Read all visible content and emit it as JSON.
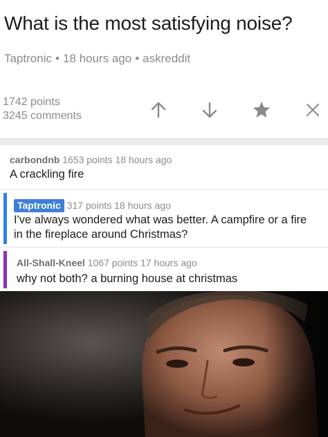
{
  "post": {
    "title": "What is the most satisfying noise?",
    "author": "Taptronic",
    "time": "18 hours ago",
    "subreddit": "askreddit",
    "points": "1742 points",
    "comments": "3245 comments"
  },
  "actions": {
    "icons": [
      "upvote-arrow-icon",
      "downvote-arrow-icon",
      "star-icon",
      "close-icon"
    ]
  },
  "comments": [
    {
      "author": "carbondnb",
      "meta": "1653 points 18 hours ago",
      "body": "A crackling fire"
    },
    {
      "author": "Taptronic",
      "meta": "317 points 18 hours ago",
      "body": "I've always wondered what was better. A campfire or a fire in the fireplace around Christmas?"
    },
    {
      "author": "All-Shall-Kneel",
      "meta": "1067 points 17 hours ago",
      "body": "why not both? a burning house at christmas"
    }
  ],
  "colors": {
    "op_badge": "#3d7fd8",
    "level2_bar": "#2f80ed",
    "level3_bar": "#8e2fb5",
    "icon_gray": "#8a8a8a"
  }
}
